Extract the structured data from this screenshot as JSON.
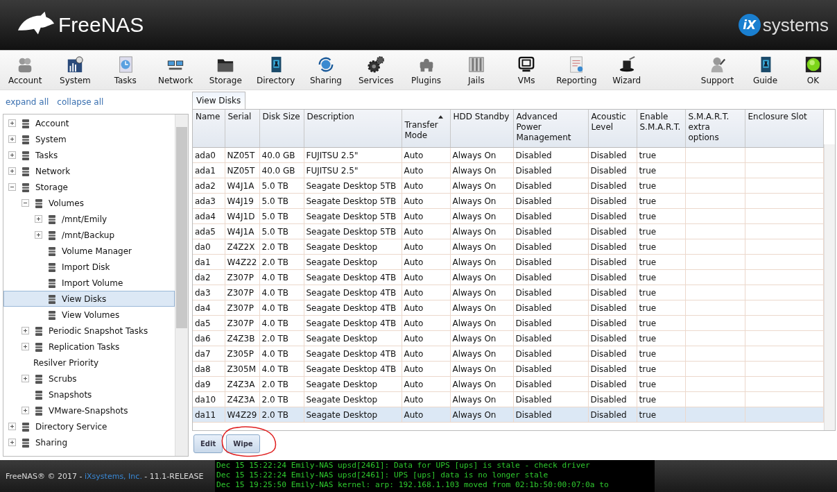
{
  "header": {
    "logo": "FreeNAS",
    "vendor": {
      "mark": "iX",
      "word": "systems"
    }
  },
  "toolbar": {
    "items": [
      {
        "label": "Account"
      },
      {
        "label": "System"
      },
      {
        "label": "Tasks"
      },
      {
        "label": "Network"
      },
      {
        "label": "Storage"
      },
      {
        "label": "Directory"
      },
      {
        "label": "Sharing"
      },
      {
        "label": "Services"
      },
      {
        "label": "Plugins"
      },
      {
        "label": "Jails"
      },
      {
        "label": "VMs"
      },
      {
        "label": "Reporting"
      },
      {
        "label": "Wizard"
      }
    ],
    "right_items": [
      {
        "label": "Support"
      },
      {
        "label": "Guide"
      },
      {
        "label": "OK"
      }
    ]
  },
  "sidebar": {
    "links": [
      "expand all",
      "collapse all"
    ],
    "tree": [
      {
        "label": "Account",
        "expandable": true,
        "expanded": false,
        "selected": false,
        "has_icon": true
      },
      {
        "label": "System",
        "expandable": true,
        "expanded": false,
        "selected": false,
        "has_icon": true
      },
      {
        "label": "Tasks",
        "expandable": true,
        "expanded": false,
        "selected": false,
        "has_icon": true
      },
      {
        "label": "Network",
        "expandable": true,
        "expanded": false,
        "selected": false,
        "has_icon": true
      },
      {
        "label": "Storage",
        "expandable": true,
        "expanded": true,
        "selected": false,
        "has_icon": true,
        "children": [
          {
            "label": "Volumes",
            "expandable": true,
            "expanded": true,
            "selected": false,
            "has_icon": true,
            "children": [
              {
                "label": "/mnt/Emily",
                "expandable": true,
                "expanded": false,
                "selected": false,
                "has_icon": true
              },
              {
                "label": "/mnt/Backup",
                "expandable": true,
                "expanded": false,
                "selected": false,
                "has_icon": true
              },
              {
                "label": "Volume Manager",
                "expandable": false,
                "expanded": false,
                "selected": false,
                "has_icon": true
              },
              {
                "label": "Import Disk",
                "expandable": false,
                "expanded": false,
                "selected": false,
                "has_icon": true
              },
              {
                "label": "Import Volume",
                "expandable": false,
                "expanded": false,
                "selected": false,
                "has_icon": true
              },
              {
                "label": "View Disks",
                "expandable": false,
                "expanded": false,
                "selected": true,
                "has_icon": true
              },
              {
                "label": "View Volumes",
                "expandable": false,
                "expanded": false,
                "selected": false,
                "has_icon": true
              }
            ]
          },
          {
            "label": "Periodic Snapshot Tasks",
            "expandable": true,
            "expanded": false,
            "selected": false,
            "has_icon": true
          },
          {
            "label": "Replication Tasks",
            "expandable": true,
            "expanded": false,
            "selected": false,
            "has_icon": true
          },
          {
            "label": "Resilver Priority",
            "expandable": false,
            "expanded": false,
            "selected": false,
            "has_icon": false
          },
          {
            "label": "Scrubs",
            "expandable": true,
            "expanded": false,
            "selected": false,
            "has_icon": true
          },
          {
            "label": "Snapshots",
            "expandable": false,
            "expanded": false,
            "selected": false,
            "has_icon": true
          },
          {
            "label": "VMware-Snapshots",
            "expandable": true,
            "expanded": false,
            "selected": false,
            "has_icon": true
          }
        ]
      },
      {
        "label": "Directory Service",
        "expandable": true,
        "expanded": false,
        "selected": false,
        "has_icon": true
      },
      {
        "label": "Sharing",
        "expandable": true,
        "expanded": false,
        "selected": false,
        "has_icon": true
      }
    ]
  },
  "tabs": [
    {
      "label": "View Disks",
      "selected": true
    }
  ],
  "table": {
    "columns": [
      {
        "label": "Name",
        "sorted": false
      },
      {
        "label": "Serial",
        "sorted": false
      },
      {
        "label": "Disk Size",
        "sorted": false
      },
      {
        "label": "Description",
        "sorted": false
      },
      {
        "label": "Transfer Mode",
        "sorted": true
      },
      {
        "label": "HDD Standby",
        "sorted": false
      },
      {
        "label": "Advanced Power Management",
        "sorted": false
      },
      {
        "label": "Acoustic Level",
        "sorted": false
      },
      {
        "label": "Enable S.M.A.R.T.",
        "sorted": false
      },
      {
        "label": "S.M.A.R.T. extra options",
        "sorted": false
      },
      {
        "label": "Enclosure Slot",
        "sorted": false
      }
    ],
    "rows": [
      {
        "selected": false,
        "cells": [
          "ada0",
          "NZ05T",
          "40.0 GB",
          "FUJITSU 2.5\"",
          "Auto",
          "Always On",
          "Disabled",
          "Disabled",
          "true"
        ]
      },
      {
        "selected": false,
        "cells": [
          "ada1",
          "NZ05T",
          "40.0 GB",
          "FUJITSU 2.5\"",
          "Auto",
          "Always On",
          "Disabled",
          "Disabled",
          "true"
        ]
      },
      {
        "selected": false,
        "cells": [
          "ada2",
          "W4J1A",
          "5.0 TB",
          "Seagate Desktop 5TB",
          "Auto",
          "Always On",
          "Disabled",
          "Disabled",
          "true"
        ]
      },
      {
        "selected": false,
        "cells": [
          "ada3",
          "W4J19",
          "5.0 TB",
          "Seagate Desktop 5TB",
          "Auto",
          "Always On",
          "Disabled",
          "Disabled",
          "true"
        ]
      },
      {
        "selected": false,
        "cells": [
          "ada4",
          "W4J1D",
          "5.0 TB",
          "Seagate Desktop 5TB",
          "Auto",
          "Always On",
          "Disabled",
          "Disabled",
          "true"
        ]
      },
      {
        "selected": false,
        "cells": [
          "ada5",
          "W4J1A",
          "5.0 TB",
          "Seagate Desktop 5TB",
          "Auto",
          "Always On",
          "Disabled",
          "Disabled",
          "true"
        ]
      },
      {
        "selected": false,
        "cells": [
          "da0",
          "Z4Z2X",
          "2.0 TB",
          "Seagate Desktop",
          "Auto",
          "Always On",
          "Disabled",
          "Disabled",
          "true"
        ]
      },
      {
        "selected": false,
        "cells": [
          "da1",
          "W4Z22",
          "2.0 TB",
          "Seagate Desktop",
          "Auto",
          "Always On",
          "Disabled",
          "Disabled",
          "true"
        ]
      },
      {
        "selected": false,
        "cells": [
          "da2",
          "Z307P",
          "4.0 TB",
          "Seagate Desktop 4TB",
          "Auto",
          "Always On",
          "Disabled",
          "Disabled",
          "true"
        ]
      },
      {
        "selected": false,
        "cells": [
          "da3",
          "Z307P",
          "4.0 TB",
          "Seagate Desktop 4TB",
          "Auto",
          "Always On",
          "Disabled",
          "Disabled",
          "true"
        ]
      },
      {
        "selected": false,
        "cells": [
          "da4",
          "Z307P",
          "4.0 TB",
          "Seagate Desktop 4TB",
          "Auto",
          "Always On",
          "Disabled",
          "Disabled",
          "true"
        ]
      },
      {
        "selected": false,
        "cells": [
          "da5",
          "Z307P",
          "4.0 TB",
          "Seagate Desktop 4TB",
          "Auto",
          "Always On",
          "Disabled",
          "Disabled",
          "true"
        ]
      },
      {
        "selected": false,
        "cells": [
          "da6",
          "Z4Z3B",
          "2.0 TB",
          "Seagate Desktop",
          "Auto",
          "Always On",
          "Disabled",
          "Disabled",
          "true"
        ]
      },
      {
        "selected": false,
        "cells": [
          "da7",
          "Z305P",
          "4.0 TB",
          "Seagate Desktop 4TB",
          "Auto",
          "Always On",
          "Disabled",
          "Disabled",
          "true"
        ]
      },
      {
        "selected": false,
        "cells": [
          "da8",
          "Z305M",
          "4.0 TB",
          "Seagate Desktop 4TB",
          "Auto",
          "Always On",
          "Disabled",
          "Disabled",
          "true"
        ]
      },
      {
        "selected": false,
        "cells": [
          "da9",
          "Z4Z3A",
          "2.0 TB",
          "Seagate Desktop",
          "Auto",
          "Always On",
          "Disabled",
          "Disabled",
          "true"
        ]
      },
      {
        "selected": false,
        "cells": [
          "da10",
          "Z4Z3A",
          "2.0 TB",
          "Seagate Desktop",
          "Auto",
          "Always On",
          "Disabled",
          "Disabled",
          "true"
        ]
      },
      {
        "selected": true,
        "cells": [
          "da11",
          "W4Z29",
          "2.0 TB",
          "Seagate Desktop",
          "Auto",
          "Always On",
          "Disabled",
          "Disabled",
          "true"
        ]
      }
    ]
  },
  "buttons": [
    "Edit",
    "Wipe"
  ],
  "footer": {
    "before": "FreeNAS® © 2017 - ",
    "company": "iXsystems, Inc.",
    "after": " - 11.1-RELEASE"
  },
  "console": [
    "Dec 15 15:22:24 Emily-NAS upsd[2461]: Data for UPS [ups] is stale - check driver",
    "Dec 15 15:22:24 Emily-NAS upsd[2461]: UPS [ups] data is no longer stale",
    "Dec 15 19:25:50 Emily-NAS kernel: arp: 192.168.1.103 moved from 02:1b:50:00:07:0a to"
  ]
}
